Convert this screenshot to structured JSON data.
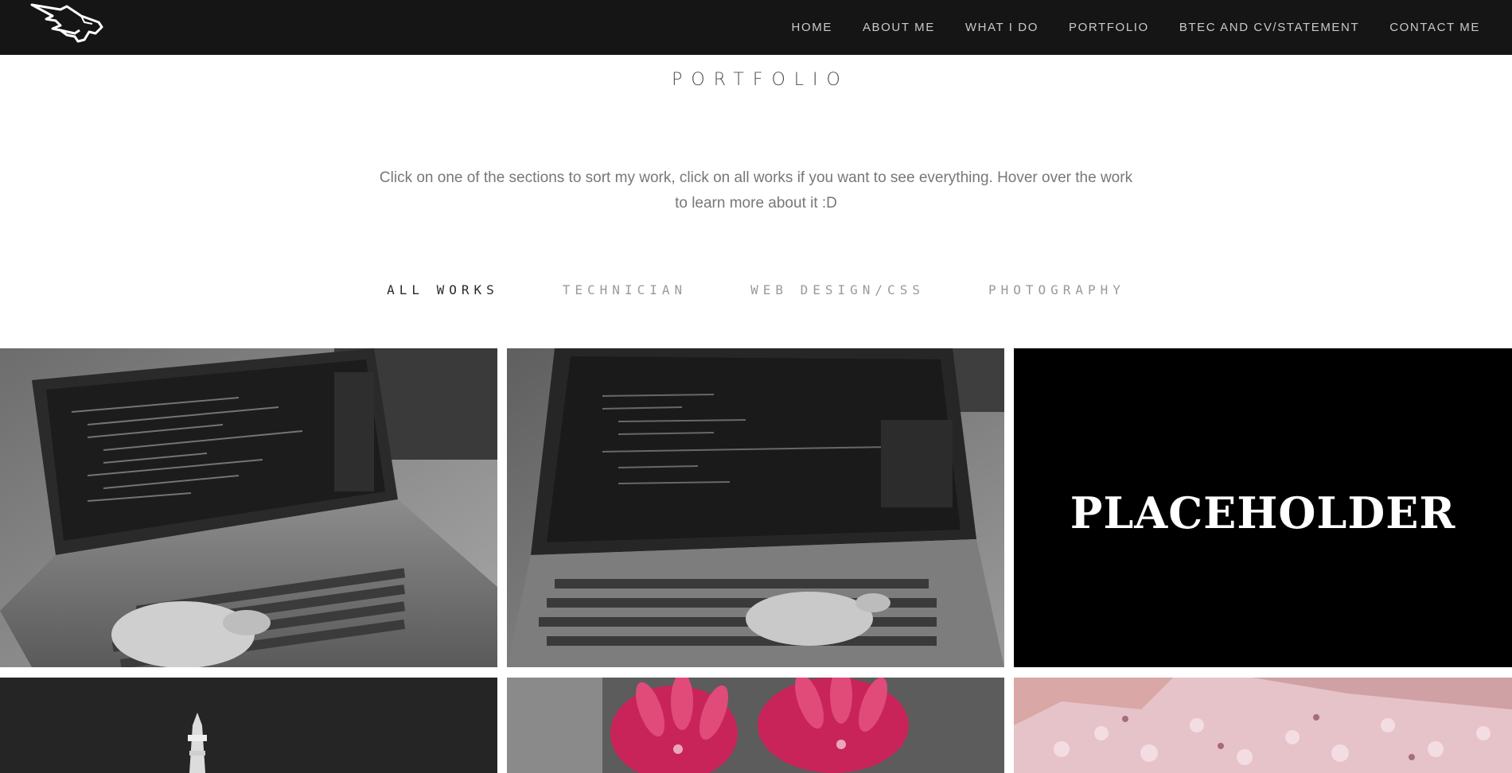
{
  "nav": {
    "logo_icon": "bull-head-logo-icon",
    "items": [
      {
        "label": "HOME"
      },
      {
        "label": "ABOUT ME"
      },
      {
        "label": "WHAT I DO"
      },
      {
        "label": "PORTFOLIO"
      },
      {
        "label": "BTEC AND CV/STATEMENT"
      },
      {
        "label": "CONTACT ME"
      }
    ]
  },
  "header": {
    "title": "PORTFOLIO",
    "intro": "Click on one of the sections to sort my work, click on all works if you want to see everything. Hover over the work to learn more about it :D"
  },
  "filters": {
    "items": [
      {
        "label": "ALL WORKS",
        "active": true
      },
      {
        "label": "TECHNICIAN",
        "active": false
      },
      {
        "label": "WEB DESIGN/CSS",
        "active": false
      },
      {
        "label": "PHOTOGRAPHY",
        "active": false
      }
    ]
  },
  "gallery": {
    "tiles": [
      {
        "kind": "photo",
        "subject": "laptop-coding-photo"
      },
      {
        "kind": "photo",
        "subject": "laptop-ide-photo"
      },
      {
        "kind": "text",
        "text": "PLACEHOLDER"
      },
      {
        "kind": "photo",
        "subject": "tower-night-photo"
      },
      {
        "kind": "photo",
        "subject": "pink-flower-photo"
      },
      {
        "kind": "photo",
        "subject": "pink-texture-photo"
      }
    ]
  },
  "colors": {
    "navbar_bg": "#151515",
    "nav_text": "#c9c9c9",
    "title_text": "#4a4a4a",
    "filter_inactive": "#9a9a9a",
    "accent_pink": "#c8245a"
  }
}
